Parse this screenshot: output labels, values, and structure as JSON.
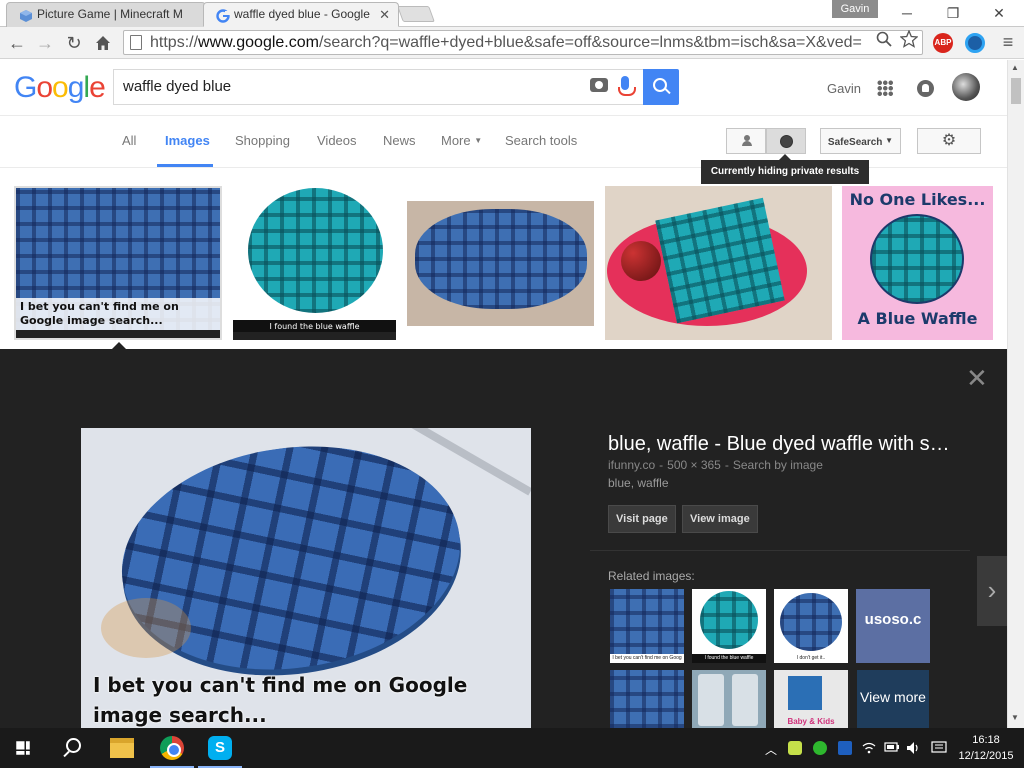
{
  "browser": {
    "tabs": [
      {
        "title": "Picture Game | Minecraft M",
        "active": false
      },
      {
        "title": "waffle dyed blue - Google",
        "active": true
      }
    ],
    "profile_name": "Gavin",
    "url_scheme": "https://",
    "url_host": "www.google.com",
    "url_path": "/search?q=waffle+dyed+blue&safe=off&source=lnms&tbm=isch&sa=X&ved=",
    "extensions": {
      "abp_label": "ABP"
    }
  },
  "google": {
    "query": "waffle dyed blue",
    "username": "Gavin",
    "nav": [
      {
        "label": "All",
        "active": false
      },
      {
        "label": "Images",
        "active": true
      },
      {
        "label": "Shopping",
        "active": false
      },
      {
        "label": "Videos",
        "active": false
      },
      {
        "label": "News",
        "active": false
      },
      {
        "label": "More",
        "active": false
      },
      {
        "label": "Search tools",
        "active": false
      }
    ],
    "safesearch_label": "SafeSearch",
    "tooltip": "Currently hiding private results"
  },
  "results": [
    {
      "caption": "I bet you can't find me on Google image search...",
      "style": "light"
    },
    {
      "caption": "I found the blue waffle",
      "style": "dark"
    },
    {
      "caption": "",
      "style": "none"
    },
    {
      "caption": "",
      "style": "none"
    },
    {
      "caption_top": "No One Likes...",
      "caption_bottom": "A Blue Waffle",
      "style": "cartoon"
    }
  ],
  "panel": {
    "title": "blue, waffle - Blue dyed waffle with s…",
    "source": "ifunny.co",
    "dimensions": "500 × 365",
    "search_by_image": "Search by image",
    "tags": "blue, waffle",
    "image_caption": "I bet you can't find me on Google image search...",
    "visit_page": "Visit page",
    "view_image": "View image",
    "related_label": "Related images:",
    "related_captions": [
      "I bet you can't find me on Goog",
      "I found the blue waffle",
      "I don't get it..",
      "usoso.c",
      "",
      "",
      "Baby & Kids",
      ""
    ],
    "view_more": "View more"
  },
  "taskbar": {
    "time": "16:18",
    "date": "12/12/2015",
    "skype_letter": "S"
  },
  "colors": {
    "google_blue": "#4285f4",
    "panel_bg": "#222222",
    "taskbar_bg": "#1a1a1a"
  }
}
